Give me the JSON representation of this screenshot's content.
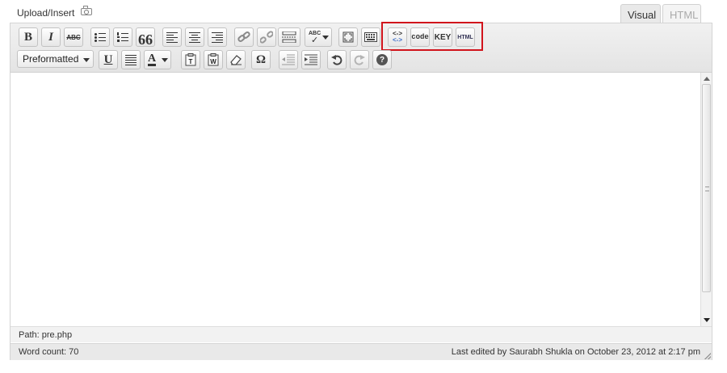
{
  "upload": {
    "label": "Upload/Insert",
    "icon": "camera-icon"
  },
  "tabs": [
    {
      "label": "Visual",
      "active": true
    },
    {
      "label": "HTML",
      "active": false
    }
  ],
  "toolbar_row1": [
    {
      "name": "bold",
      "text": "B"
    },
    {
      "name": "italic",
      "text": "I"
    },
    {
      "name": "strikethrough",
      "text": "ABC"
    },
    {
      "name": "bullet-list",
      "icon": "bullet-list-icon"
    },
    {
      "name": "numbered-list",
      "icon": "numbered-list-icon"
    },
    {
      "name": "blockquote",
      "text": "66"
    },
    {
      "name": "align-left",
      "icon": "align-left-icon"
    },
    {
      "name": "align-center",
      "icon": "align-center-icon"
    },
    {
      "name": "align-right",
      "icon": "align-right-icon"
    },
    {
      "name": "insert-link",
      "icon": "link-icon"
    },
    {
      "name": "remove-link",
      "icon": "unlink-icon"
    },
    {
      "name": "insert-more",
      "icon": "more-tag-icon"
    },
    {
      "name": "spellcheck",
      "text": "ABC",
      "icon": "spellcheck-icon"
    },
    {
      "name": "fullscreen",
      "icon": "fullscreen-icon"
    },
    {
      "name": "kitchen-sink",
      "icon": "kitchen-sink-icon"
    },
    {
      "name": "insert-pre",
      "text": "<->"
    },
    {
      "name": "insert-code",
      "text": "code"
    },
    {
      "name": "insert-kbd",
      "text": "KEY"
    },
    {
      "name": "insert-html",
      "text": "HTML"
    }
  ],
  "toolbar_row2": {
    "format_select": {
      "value": "Preformatted"
    },
    "buttons": [
      {
        "name": "underline",
        "text": "U"
      },
      {
        "name": "justify",
        "icon": "justify-icon"
      },
      {
        "name": "text-color",
        "text": "A"
      },
      {
        "name": "paste-text",
        "icon": "paste-text-icon"
      },
      {
        "name": "paste-word",
        "icon": "paste-word-icon"
      },
      {
        "name": "clear-formatting",
        "icon": "eraser-icon"
      },
      {
        "name": "special-char",
        "text": "Ω"
      },
      {
        "name": "outdent",
        "icon": "outdent-icon"
      },
      {
        "name": "indent",
        "icon": "indent-icon"
      },
      {
        "name": "undo",
        "icon": "undo-icon"
      },
      {
        "name": "redo",
        "icon": "redo-icon"
      },
      {
        "name": "help",
        "text": "?"
      }
    ]
  },
  "highlight_color": "#d1141c",
  "path": {
    "label": "Path:",
    "value": "pre.php"
  },
  "status": {
    "word_count": "Word count: 70",
    "last_edited": "Last edited by Saurabh Shukla on October 23, 2012 at 2:17 pm"
  }
}
